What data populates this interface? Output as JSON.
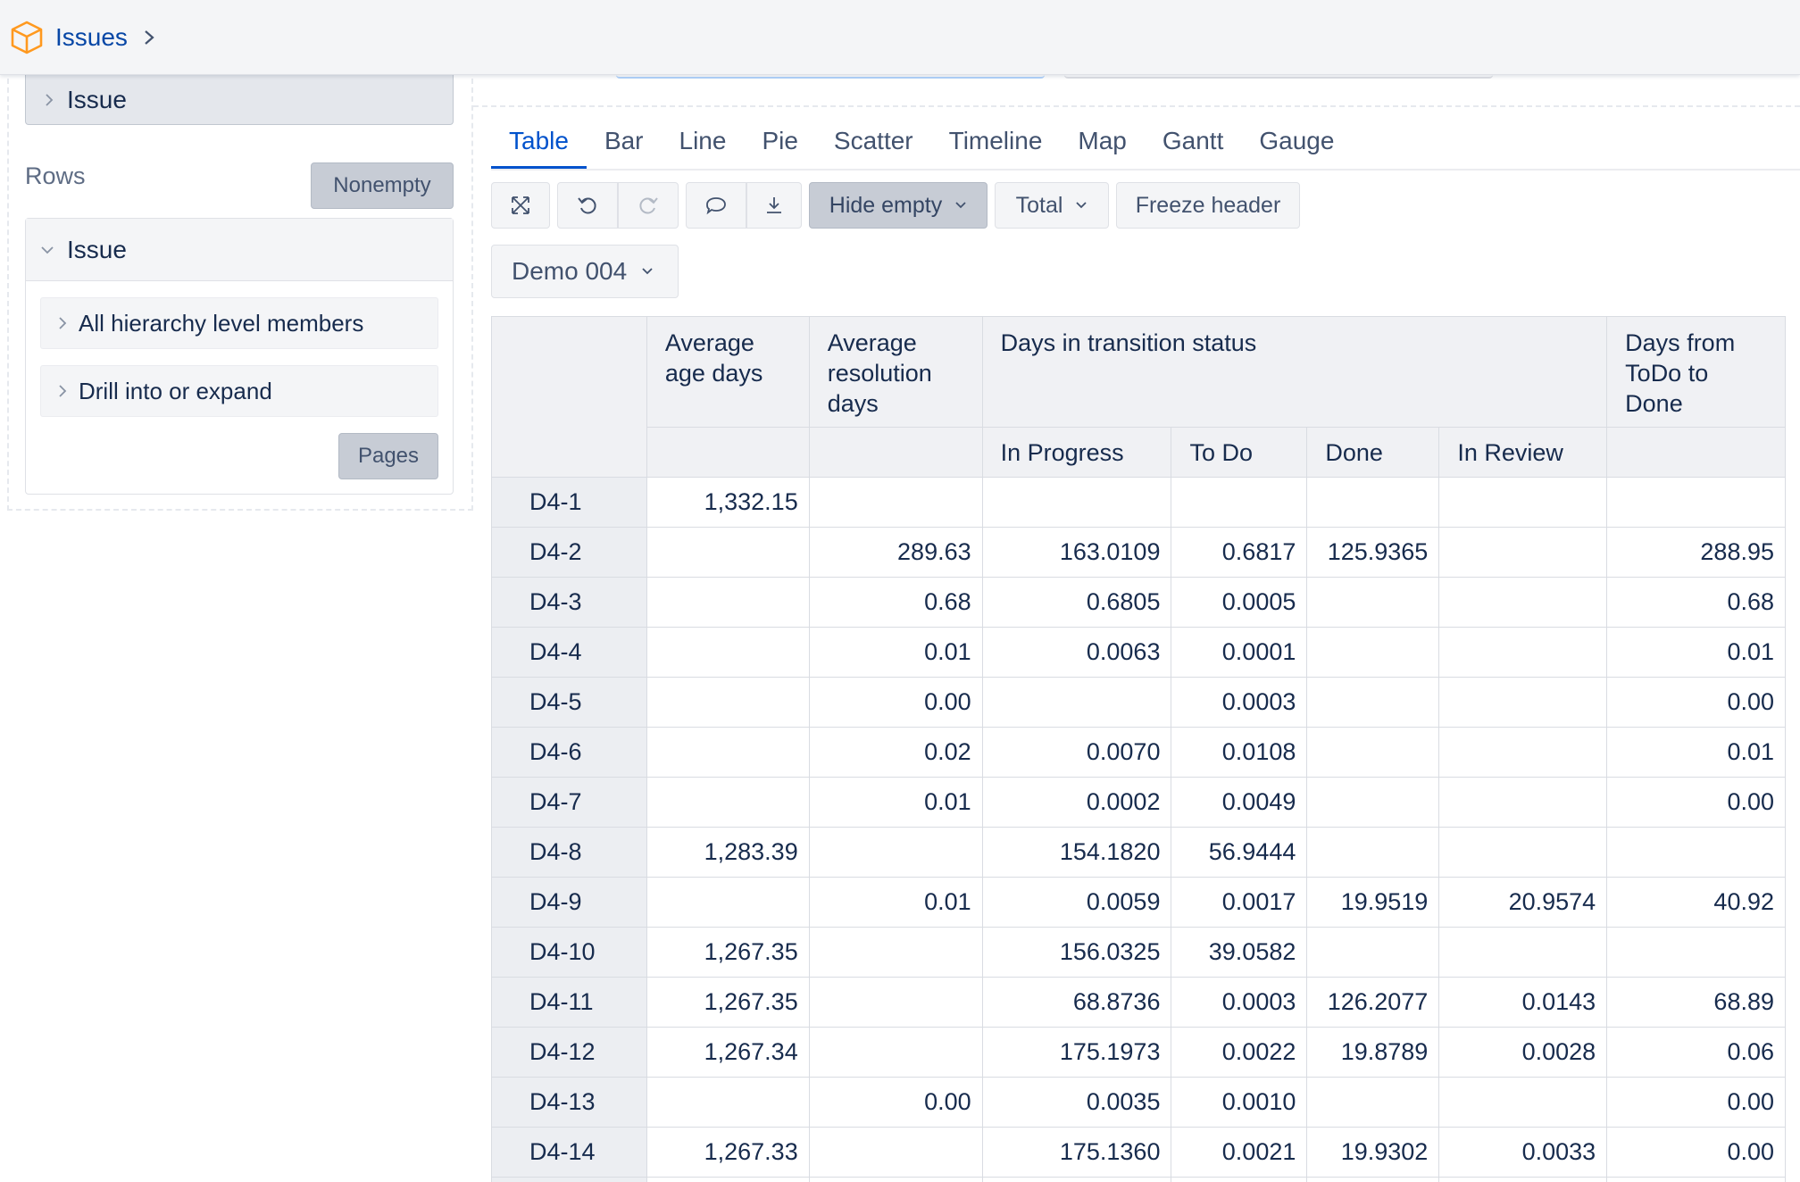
{
  "header": {
    "breadcrumb": "Issues",
    "icon": "cube-icon"
  },
  "left": {
    "issue_top_label": "Issue",
    "rows_title": "Rows",
    "nonempty_label": "Nonempty",
    "card_title": "Issue",
    "items": [
      "All hierarchy level members",
      "Drill into or expand"
    ],
    "pages_label": "Pages"
  },
  "tabs": [
    "Table",
    "Bar",
    "Line",
    "Pie",
    "Scatter",
    "Timeline",
    "Map",
    "Gantt",
    "Gauge"
  ],
  "active_tab": "Table",
  "toolbar": {
    "hide_empty": "Hide empty",
    "total": "Total",
    "freeze_header": "Freeze header"
  },
  "page_select": "Demo 004",
  "table": {
    "headers": {
      "avg_age": "Average age days",
      "avg_res": "Average resolution days",
      "transition": "Days in transition status",
      "todo_done": "Days from ToDo to Done",
      "sub": [
        "In Progress",
        "To Do",
        "Done",
        "In Review"
      ]
    },
    "rows": [
      {
        "id": "D4-1",
        "cells": [
          "1,332.15",
          "",
          "",
          "",
          "",
          "",
          ""
        ]
      },
      {
        "id": "D4-2",
        "cells": [
          "",
          "289.63",
          "163.0109",
          "0.6817",
          "125.9365",
          "",
          "288.95"
        ]
      },
      {
        "id": "D4-3",
        "cells": [
          "",
          "0.68",
          "0.6805",
          "0.0005",
          "",
          "",
          "0.68"
        ]
      },
      {
        "id": "D4-4",
        "cells": [
          "",
          "0.01",
          "0.0063",
          "0.0001",
          "",
          "",
          "0.01"
        ]
      },
      {
        "id": "D4-5",
        "cells": [
          "",
          "0.00",
          "",
          "0.0003",
          "",
          "",
          "0.00"
        ]
      },
      {
        "id": "D4-6",
        "cells": [
          "",
          "0.02",
          "0.0070",
          "0.0108",
          "",
          "",
          "0.01"
        ]
      },
      {
        "id": "D4-7",
        "cells": [
          "",
          "0.01",
          "0.0002",
          "0.0049",
          "",
          "",
          "0.00"
        ]
      },
      {
        "id": "D4-8",
        "cells": [
          "1,283.39",
          "",
          "154.1820",
          "56.9444",
          "",
          "",
          ""
        ]
      },
      {
        "id": "D4-9",
        "cells": [
          "",
          "0.01",
          "0.0059",
          "0.0017",
          "19.9519",
          "20.9574",
          "40.92"
        ]
      },
      {
        "id": "D4-10",
        "cells": [
          "1,267.35",
          "",
          "156.0325",
          "39.0582",
          "",
          "",
          ""
        ]
      },
      {
        "id": "D4-11",
        "cells": [
          "1,267.35",
          "",
          "68.8736",
          "0.0003",
          "126.2077",
          "0.0143",
          "68.89"
        ]
      },
      {
        "id": "D4-12",
        "cells": [
          "1,267.34",
          "",
          "175.1973",
          "0.0022",
          "19.8789",
          "0.0028",
          "0.06"
        ]
      },
      {
        "id": "D4-13",
        "cells": [
          "",
          "0.00",
          "0.0035",
          "0.0010",
          "",
          "",
          "0.00"
        ]
      },
      {
        "id": "D4-14",
        "cells": [
          "1,267.33",
          "",
          "175.1360",
          "0.0021",
          "19.9302",
          "0.0033",
          "0.00"
        ]
      },
      {
        "id": "",
        "cells": [
          "",
          "",
          "",
          "",
          "",
          "",
          ""
        ]
      }
    ]
  },
  "colors": {
    "accent": "#0052cc",
    "brand_icon": "#ff991f"
  }
}
